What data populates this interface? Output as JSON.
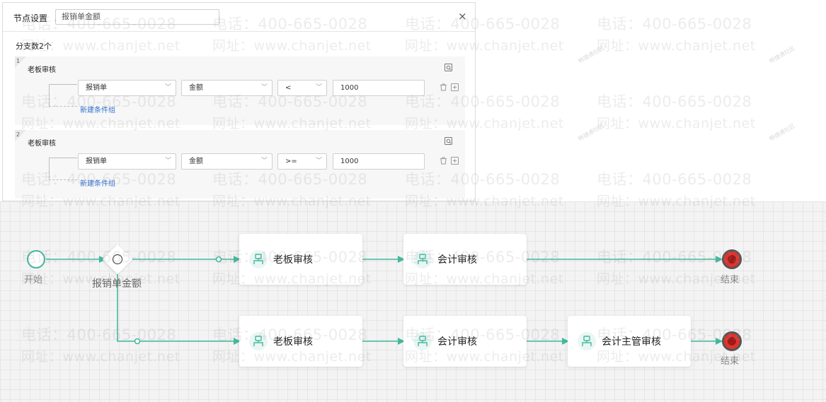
{
  "panel": {
    "title": "节点设置",
    "name_value": "报销单金额",
    "close_glyph": "×",
    "branch_count": "分支数2个",
    "branches": [
      {
        "number": "1",
        "name": "老板审核",
        "condition": {
          "form": "报销单",
          "field": "金额",
          "operator": "<",
          "value": "1000"
        },
        "new_group": "新建条件组"
      },
      {
        "number": "2",
        "name": "老板审核",
        "condition": {
          "form": "报销单",
          "field": "金额",
          "operator": ">=",
          "value": "1000"
        },
        "new_group": "新建条件组"
      }
    ],
    "icons": {
      "node": "node-settings-icon",
      "delete": "trash-icon",
      "add": "plus-square-icon"
    }
  },
  "flow": {
    "start_label": "开始",
    "gateway_label": "报销单金额",
    "row1": [
      "老板审核",
      "会计审核"
    ],
    "row2": [
      "老板审核",
      "会计审核",
      "会计主管审核"
    ],
    "end_label": "结束"
  },
  "watermark": {
    "phone": "电话：400-665-0028",
    "site": "网址：www.chanjet.net",
    "stamp": "畅捷通社区"
  },
  "colors": {
    "edge": "#43b89f",
    "end": "#e0332d",
    "link": "#2f6fce",
    "node_icon": "#43b89f"
  }
}
